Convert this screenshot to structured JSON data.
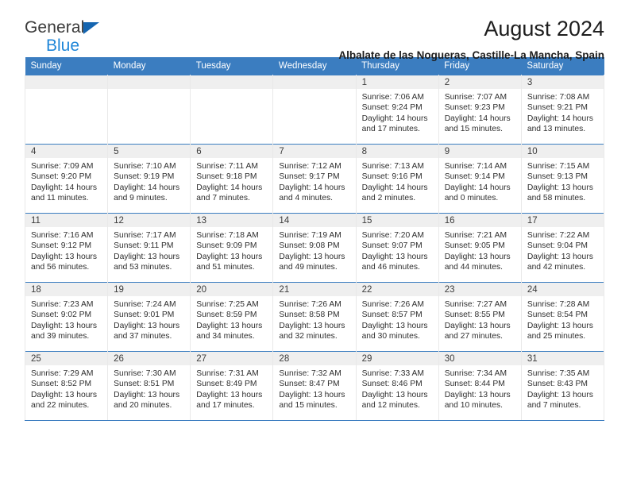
{
  "brand": {
    "name_top": "General",
    "name_bottom": "Blue",
    "accent_color": "#1f86d8",
    "triangle_color": "#1565b0"
  },
  "header": {
    "title": "August 2024",
    "subtitle": "Albalate de las Nogueras, Castille-La Mancha, Spain"
  },
  "calendar": {
    "header_bg": "#3b7dc0",
    "daynum_bg": "#efefef",
    "weekday_headers": [
      "Sunday",
      "Monday",
      "Tuesday",
      "Wednesday",
      "Thursday",
      "Friday",
      "Saturday"
    ],
    "weeks": [
      [
        {
          "day": "",
          "sunrise": "",
          "sunset": "",
          "daylight_line1": "",
          "daylight_line2": ""
        },
        {
          "day": "",
          "sunrise": "",
          "sunset": "",
          "daylight_line1": "",
          "daylight_line2": ""
        },
        {
          "day": "",
          "sunrise": "",
          "sunset": "",
          "daylight_line1": "",
          "daylight_line2": ""
        },
        {
          "day": "",
          "sunrise": "",
          "sunset": "",
          "daylight_line1": "",
          "daylight_line2": ""
        },
        {
          "day": "1",
          "sunrise": "Sunrise: 7:06 AM",
          "sunset": "Sunset: 9:24 PM",
          "daylight_line1": "Daylight: 14 hours",
          "daylight_line2": "and 17 minutes."
        },
        {
          "day": "2",
          "sunrise": "Sunrise: 7:07 AM",
          "sunset": "Sunset: 9:23 PM",
          "daylight_line1": "Daylight: 14 hours",
          "daylight_line2": "and 15 minutes."
        },
        {
          "day": "3",
          "sunrise": "Sunrise: 7:08 AM",
          "sunset": "Sunset: 9:21 PM",
          "daylight_line1": "Daylight: 14 hours",
          "daylight_line2": "and 13 minutes."
        }
      ],
      [
        {
          "day": "4",
          "sunrise": "Sunrise: 7:09 AM",
          "sunset": "Sunset: 9:20 PM",
          "daylight_line1": "Daylight: 14 hours",
          "daylight_line2": "and 11 minutes."
        },
        {
          "day": "5",
          "sunrise": "Sunrise: 7:10 AM",
          "sunset": "Sunset: 9:19 PM",
          "daylight_line1": "Daylight: 14 hours",
          "daylight_line2": "and 9 minutes."
        },
        {
          "day": "6",
          "sunrise": "Sunrise: 7:11 AM",
          "sunset": "Sunset: 9:18 PM",
          "daylight_line1": "Daylight: 14 hours",
          "daylight_line2": "and 7 minutes."
        },
        {
          "day": "7",
          "sunrise": "Sunrise: 7:12 AM",
          "sunset": "Sunset: 9:17 PM",
          "daylight_line1": "Daylight: 14 hours",
          "daylight_line2": "and 4 minutes."
        },
        {
          "day": "8",
          "sunrise": "Sunrise: 7:13 AM",
          "sunset": "Sunset: 9:16 PM",
          "daylight_line1": "Daylight: 14 hours",
          "daylight_line2": "and 2 minutes."
        },
        {
          "day": "9",
          "sunrise": "Sunrise: 7:14 AM",
          "sunset": "Sunset: 9:14 PM",
          "daylight_line1": "Daylight: 14 hours",
          "daylight_line2": "and 0 minutes."
        },
        {
          "day": "10",
          "sunrise": "Sunrise: 7:15 AM",
          "sunset": "Sunset: 9:13 PM",
          "daylight_line1": "Daylight: 13 hours",
          "daylight_line2": "and 58 minutes."
        }
      ],
      [
        {
          "day": "11",
          "sunrise": "Sunrise: 7:16 AM",
          "sunset": "Sunset: 9:12 PM",
          "daylight_line1": "Daylight: 13 hours",
          "daylight_line2": "and 56 minutes."
        },
        {
          "day": "12",
          "sunrise": "Sunrise: 7:17 AM",
          "sunset": "Sunset: 9:11 PM",
          "daylight_line1": "Daylight: 13 hours",
          "daylight_line2": "and 53 minutes."
        },
        {
          "day": "13",
          "sunrise": "Sunrise: 7:18 AM",
          "sunset": "Sunset: 9:09 PM",
          "daylight_line1": "Daylight: 13 hours",
          "daylight_line2": "and 51 minutes."
        },
        {
          "day": "14",
          "sunrise": "Sunrise: 7:19 AM",
          "sunset": "Sunset: 9:08 PM",
          "daylight_line1": "Daylight: 13 hours",
          "daylight_line2": "and 49 minutes."
        },
        {
          "day": "15",
          "sunrise": "Sunrise: 7:20 AM",
          "sunset": "Sunset: 9:07 PM",
          "daylight_line1": "Daylight: 13 hours",
          "daylight_line2": "and 46 minutes."
        },
        {
          "day": "16",
          "sunrise": "Sunrise: 7:21 AM",
          "sunset": "Sunset: 9:05 PM",
          "daylight_line1": "Daylight: 13 hours",
          "daylight_line2": "and 44 minutes."
        },
        {
          "day": "17",
          "sunrise": "Sunrise: 7:22 AM",
          "sunset": "Sunset: 9:04 PM",
          "daylight_line1": "Daylight: 13 hours",
          "daylight_line2": "and 42 minutes."
        }
      ],
      [
        {
          "day": "18",
          "sunrise": "Sunrise: 7:23 AM",
          "sunset": "Sunset: 9:02 PM",
          "daylight_line1": "Daylight: 13 hours",
          "daylight_line2": "and 39 minutes."
        },
        {
          "day": "19",
          "sunrise": "Sunrise: 7:24 AM",
          "sunset": "Sunset: 9:01 PM",
          "daylight_line1": "Daylight: 13 hours",
          "daylight_line2": "and 37 minutes."
        },
        {
          "day": "20",
          "sunrise": "Sunrise: 7:25 AM",
          "sunset": "Sunset: 8:59 PM",
          "daylight_line1": "Daylight: 13 hours",
          "daylight_line2": "and 34 minutes."
        },
        {
          "day": "21",
          "sunrise": "Sunrise: 7:26 AM",
          "sunset": "Sunset: 8:58 PM",
          "daylight_line1": "Daylight: 13 hours",
          "daylight_line2": "and 32 minutes."
        },
        {
          "day": "22",
          "sunrise": "Sunrise: 7:26 AM",
          "sunset": "Sunset: 8:57 PM",
          "daylight_line1": "Daylight: 13 hours",
          "daylight_line2": "and 30 minutes."
        },
        {
          "day": "23",
          "sunrise": "Sunrise: 7:27 AM",
          "sunset": "Sunset: 8:55 PM",
          "daylight_line1": "Daylight: 13 hours",
          "daylight_line2": "and 27 minutes."
        },
        {
          "day": "24",
          "sunrise": "Sunrise: 7:28 AM",
          "sunset": "Sunset: 8:54 PM",
          "daylight_line1": "Daylight: 13 hours",
          "daylight_line2": "and 25 minutes."
        }
      ],
      [
        {
          "day": "25",
          "sunrise": "Sunrise: 7:29 AM",
          "sunset": "Sunset: 8:52 PM",
          "daylight_line1": "Daylight: 13 hours",
          "daylight_line2": "and 22 minutes."
        },
        {
          "day": "26",
          "sunrise": "Sunrise: 7:30 AM",
          "sunset": "Sunset: 8:51 PM",
          "daylight_line1": "Daylight: 13 hours",
          "daylight_line2": "and 20 minutes."
        },
        {
          "day": "27",
          "sunrise": "Sunrise: 7:31 AM",
          "sunset": "Sunset: 8:49 PM",
          "daylight_line1": "Daylight: 13 hours",
          "daylight_line2": "and 17 minutes."
        },
        {
          "day": "28",
          "sunrise": "Sunrise: 7:32 AM",
          "sunset": "Sunset: 8:47 PM",
          "daylight_line1": "Daylight: 13 hours",
          "daylight_line2": "and 15 minutes."
        },
        {
          "day": "29",
          "sunrise": "Sunrise: 7:33 AM",
          "sunset": "Sunset: 8:46 PM",
          "daylight_line1": "Daylight: 13 hours",
          "daylight_line2": "and 12 minutes."
        },
        {
          "day": "30",
          "sunrise": "Sunrise: 7:34 AM",
          "sunset": "Sunset: 8:44 PM",
          "daylight_line1": "Daylight: 13 hours",
          "daylight_line2": "and 10 minutes."
        },
        {
          "day": "31",
          "sunrise": "Sunrise: 7:35 AM",
          "sunset": "Sunset: 8:43 PM",
          "daylight_line1": "Daylight: 13 hours",
          "daylight_line2": "and 7 minutes."
        }
      ]
    ]
  }
}
